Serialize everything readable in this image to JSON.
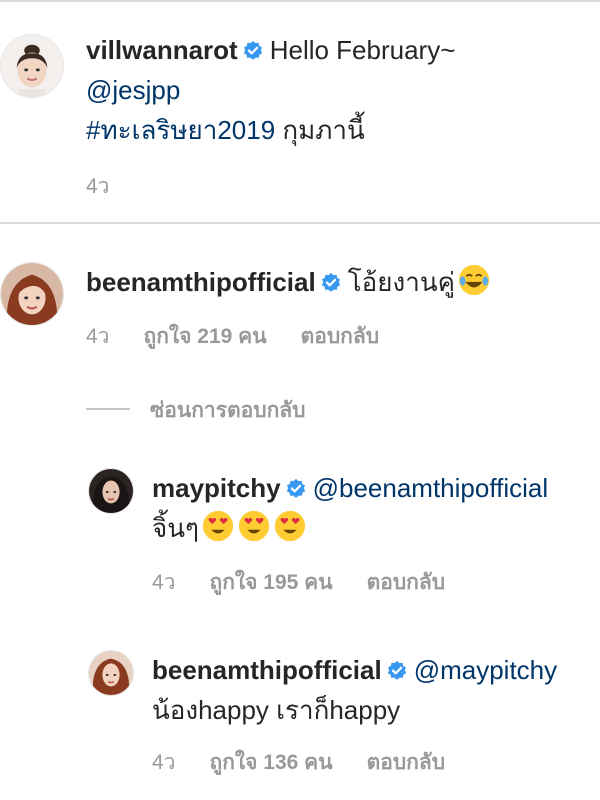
{
  "post": {
    "username": "villwannarot",
    "caption": "Hello February~",
    "mention": "@jesjpp",
    "hashtag": "#ทะเลริษยา2019",
    "caption_tail": "กุมภานี้",
    "time": "4ว"
  },
  "comments": [
    {
      "username": "beenamthipofficial",
      "text": "โอ้ยงานคู่",
      "emoji": "joy-emoji",
      "time": "4ว",
      "likes": "ถูกใจ 219 คน",
      "reply": "ตอบกลับ"
    }
  ],
  "hide_replies": "ซ่อนการตอบกลับ",
  "replies": [
    {
      "username": "maypitchy",
      "mention": "@beenamthipofficial",
      "text": "จิ้นๆ",
      "emoji": "heart-eyes-emoji",
      "time": "4ว",
      "likes": "ถูกใจ 195 คน",
      "reply": "ตอบกลับ"
    },
    {
      "username": "beenamthipofficial",
      "mention": "@maypitchy",
      "text": "น้องhappy เราก็happy",
      "time": "4ว",
      "likes": "ถูกใจ 136 คน",
      "reply": "ตอบกลับ"
    }
  ],
  "colors": {
    "link": "#003569",
    "verified": "#3897f0",
    "meta": "#999999",
    "divider": "#dbdbdb"
  }
}
